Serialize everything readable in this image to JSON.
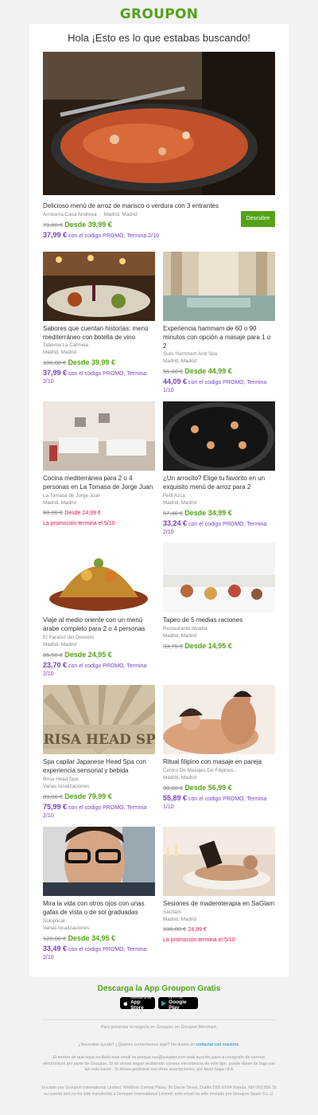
{
  "logo": "GROUPON",
  "greeting": "Hola ¡Esto es lo que estabas buscando!",
  "featured": {
    "title": "Delicioso menú de arroz de marisco o verdura con 3 entrantes",
    "merchant": "Arrocería Casa Andreea",
    "location": "Madrid, Madrid",
    "old_price": "71,00 €",
    "new_price": "Desde 39,99 €",
    "promo_price": "37,99 €",
    "promo_text": "con el codigo PROMO, Termina 2/10",
    "button": "Descubre"
  },
  "deals": [
    {
      "title": "Sabores que cuentan historias: menú mediterráneo con botella de vino",
      "merchant": "Taberna La Carmela",
      "location": "Madrid, Madrid",
      "old_price": "106,00 €",
      "new_price": "Desde 39,99 €",
      "promo_price": "37,99 €",
      "promo_text": "con el codigo PROMO, Termina 2/10"
    },
    {
      "title": "Experiencia hammam de 60 o 90 minutos con opción a masaje para 1 o 2",
      "merchant": "Sulis Hammam And Spa",
      "location": "Madrid, Madrid",
      "old_price": "55,00 €",
      "new_price": "Desde 44,99 €",
      "promo_price": "44,09 €",
      "promo_text": "con el codigo PROMO, Termina 1/10"
    },
    {
      "title": "Cocina mediterránea para 2 o 4 personas en La Tomasa de Jorge Juan",
      "merchant": "La Tomasa de Jorge Juan",
      "location": "Madrid, Madrid",
      "old_price": "60,00 €",
      "new_price": "Desde 24,99 €",
      "promo_text": "La promoción termina el 5/10"
    },
    {
      "title": "¿Un arrocito? Elige tu favorito en un exquisito menú de arroz para 2",
      "merchant": "Petit Azca",
      "location": "Madrid, Madrid",
      "old_price": "57,40 €",
      "new_price": "Desde 34,99 €",
      "promo_price": "33,24 €",
      "promo_text": "con el codigo PROMO, Termina 2/10"
    },
    {
      "title": "Viaje al medio oriente con un menú árabe completo para 2 o 4 personas",
      "merchant": "El Paraíso del Desierto",
      "location": "Madrid, Madrid",
      "old_price": "65,50 €",
      "new_price": "Desde 24,95 €",
      "promo_price": "23,70 €",
      "promo_text": "con el codigo PROMO, Termina 2/10"
    },
    {
      "title": "Tapeo de 5 medias raciones",
      "merchant": "Restaurante Abadía",
      "location": "Madrid, Madrid",
      "old_price": "33,75 €",
      "new_price": "Desde 14,95 €"
    },
    {
      "title": "Spa capilar Japanese Head Spa con experiencia sensorial y bebida",
      "merchant": "Brisa Head Spa",
      "location": "Varias localizaciones",
      "old_price": "89,00 €",
      "new_price": "Desde 79,99 €",
      "promo_price": "75,99 €",
      "promo_text": "con el codigo PROMO, Termina 2/10",
      "img_text": "BRISA HEAD SPA"
    },
    {
      "title": "Ritual filipino con masaje en pareja",
      "merchant": "Centro De Masajes De Filipinos...",
      "location": "Madrid, Madrid",
      "old_price": "90,00 €",
      "new_price": "Desde 56,99 €",
      "promo_price": "55,89 €",
      "promo_text": "con el codigo PROMO, Termina 1/10"
    },
    {
      "title": "Mira la vida con otros ojos con unas gafas de vista o de sol graduadas",
      "merchant": "Soloptical",
      "location": "Varias localizaciones",
      "old_price": "120,00 €",
      "new_price": "Desde 34,95 €",
      "promo_price": "33,49 €",
      "promo_text": "con el codigo PROMO, Termina 2/10"
    },
    {
      "title": "Sesiones de maderoterapia en SaGlam",
      "merchant": "SaGlam",
      "location": "Madrid, Madrid",
      "old_price": "100,00 €",
      "new_price": "24,99 €",
      "promo_text": "La promoción termina el 5/10"
    }
  ],
  "footer": {
    "app_title": "Descarga la App Groupon Gratis",
    "appstore_small": "Download on the",
    "appstore_big": "App Store",
    "gplay_small": "GET IT ON",
    "gplay_big": "Google Play",
    "merchant_line": "Para presentar tu negocio en Groupon, en Groupon Merchant.",
    "help_pre": "¿Necesitas ayuda? ¿Quieres comentarnos algo? No dudes en ",
    "help_link": "contactar con nosotros",
    "help_post": ".",
    "legal1": "El motivo de que haya recibido este email es porque xxx@ureader.com está suscrito para la recepción de correos electrónicos por parte de Groupon. Si no desea seguir recibiendo correos electrónicos de este tipo, puede darse de baja con tan solo hacer . Si desea gestionar sus otras suscripciones, por favor haga click",
    "legal2": "Enviado por Groupon International Limited, WeWork Central Plaza, 36 Dame Street, Dublin D02 EF64 Irlanda, NIF:501358. Si su cuenta aún no ha sido transferida a Groupon International Limited, este email ha sido enviado por Groupon Spain S.L.U."
  },
  "colors": {
    "brand": "#53a318",
    "promo": "#7b3fc5",
    "deadline": "#e2135c",
    "link": "#0185c6"
  }
}
